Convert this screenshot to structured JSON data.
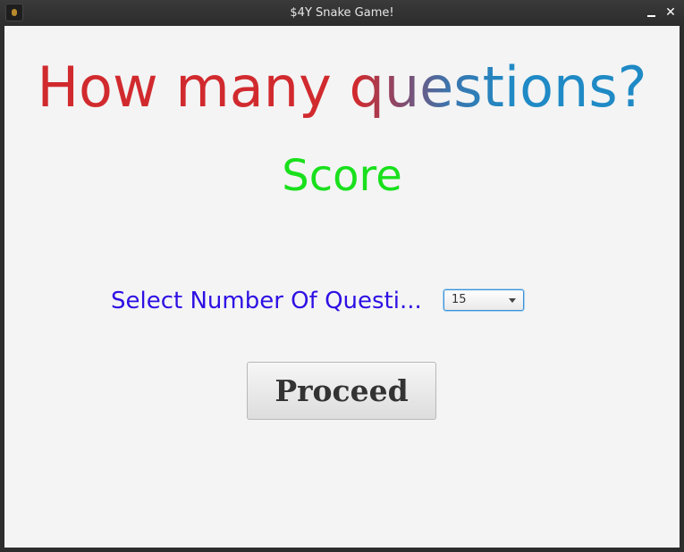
{
  "window": {
    "title": "$4Y Snake Game!",
    "close_glyph": "✕"
  },
  "main": {
    "heading": "How many questions?",
    "score_label": "Score",
    "select_label": "Select Number Of Questi...",
    "questions_dropdown": {
      "selected": "15"
    },
    "proceed_label": "Proceed"
  },
  "colors": {
    "heading_red": "#d12a2e",
    "heading_blue": "#1f8ac5",
    "score_green": "#19e01c",
    "label_blue": "#2d10e4",
    "background": "#f4f4f4"
  },
  "icons": [
    "app-icon",
    "minimize-icon",
    "close-icon",
    "dropdown-arrow-icon"
  ]
}
